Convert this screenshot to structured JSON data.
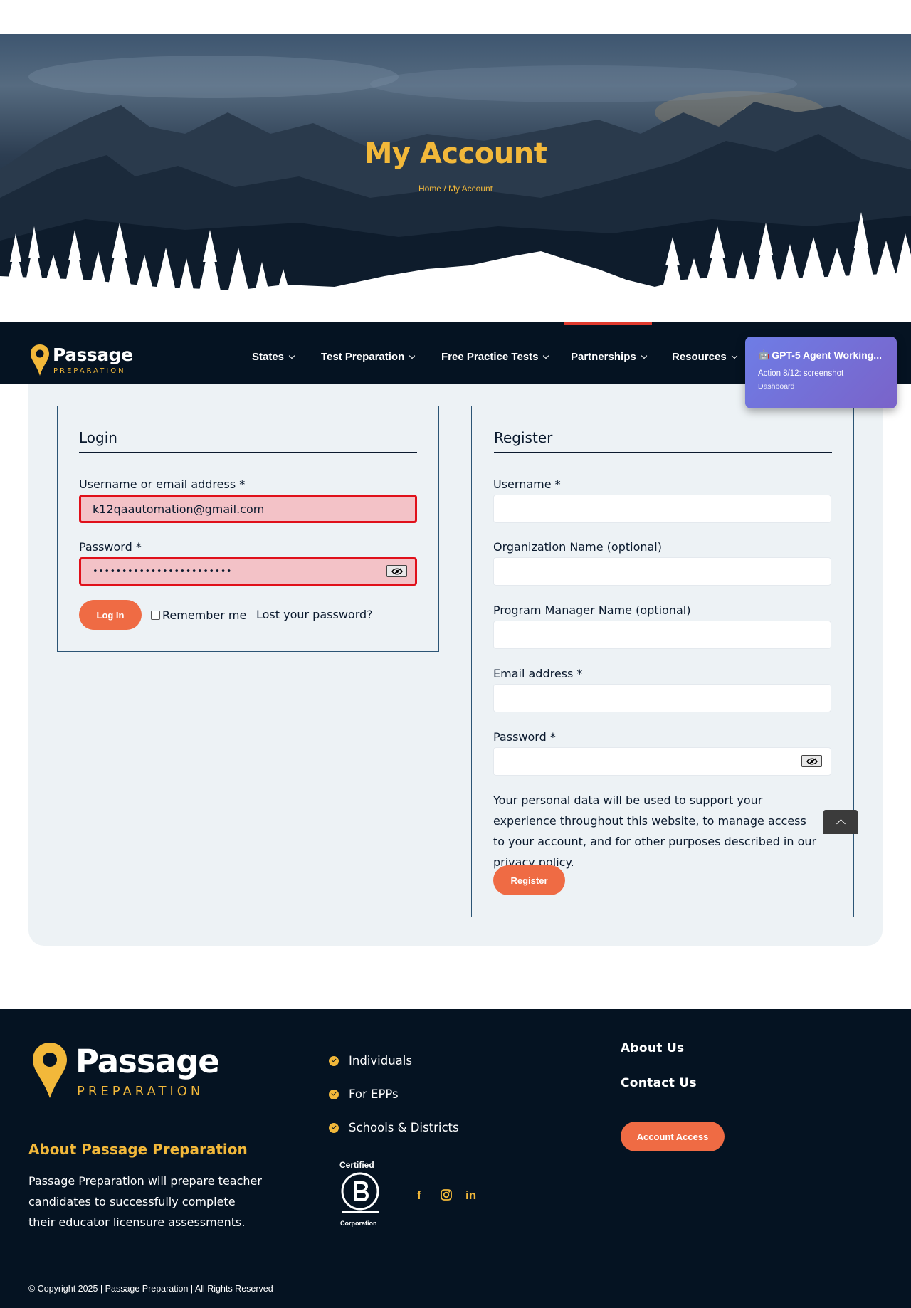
{
  "hero": {
    "title": "My Account",
    "breadcrumb_home": "Home",
    "breadcrumb_sep": " / ",
    "breadcrumb_current": "My Account"
  },
  "brand": {
    "name": "Passage",
    "tagline": "PREPARATION",
    "accent": "#f2b83a",
    "navy": "#051322",
    "orange": "#ef6b44"
  },
  "nav": {
    "items": [
      {
        "label": "States"
      },
      {
        "label": "Test Preparation"
      },
      {
        "label": "Free Practice Tests"
      },
      {
        "label": "Partnerships"
      },
      {
        "label": "Resources"
      }
    ]
  },
  "agent_toast": {
    "title": "GPT-5 Agent Working...",
    "action": "Action 8/12: screenshot",
    "page": "Dashboard"
  },
  "login": {
    "heading": "Login",
    "username_label": "Username or email address *",
    "username_value": "k12qaautomation@gmail.com",
    "password_label": "Password *",
    "password_value": "••••••••••••••••••••••••",
    "login_button": "Log In",
    "remember_label": "Remember me",
    "lost_password": "Lost your password?"
  },
  "register": {
    "heading": "Register",
    "username_label": "Username *",
    "org_label": "Organization Name (optional)",
    "pm_label": "Program Manager Name (optional)",
    "email_label": "Email address *",
    "password_label": "Password *",
    "privacy_text_1": "Your personal data will be used to support your experience throughout this website, to manage access to your account, and for other purposes described in our ",
    "privacy_link": "privacy policy",
    "privacy_text_2": ".",
    "register_button": "Register"
  },
  "footer": {
    "about_title": "About Passage Preparation",
    "about_text": "Passage Preparation will prepare teacher candidates to successfully complete their educator licensure assessments.",
    "links": [
      "Individuals",
      "For EPPs",
      "Schools & Districts"
    ],
    "right_links": [
      "About Us",
      "Contact Us"
    ],
    "account_button": "Account Access",
    "bcorp_top": "Certified",
    "bcorp_bottom": "Corporation",
    "social_facebook": "f",
    "social_linkedin": "in",
    "copyright": "© Copyright 2025 | Passage Preparation | All Rights Reserved"
  }
}
